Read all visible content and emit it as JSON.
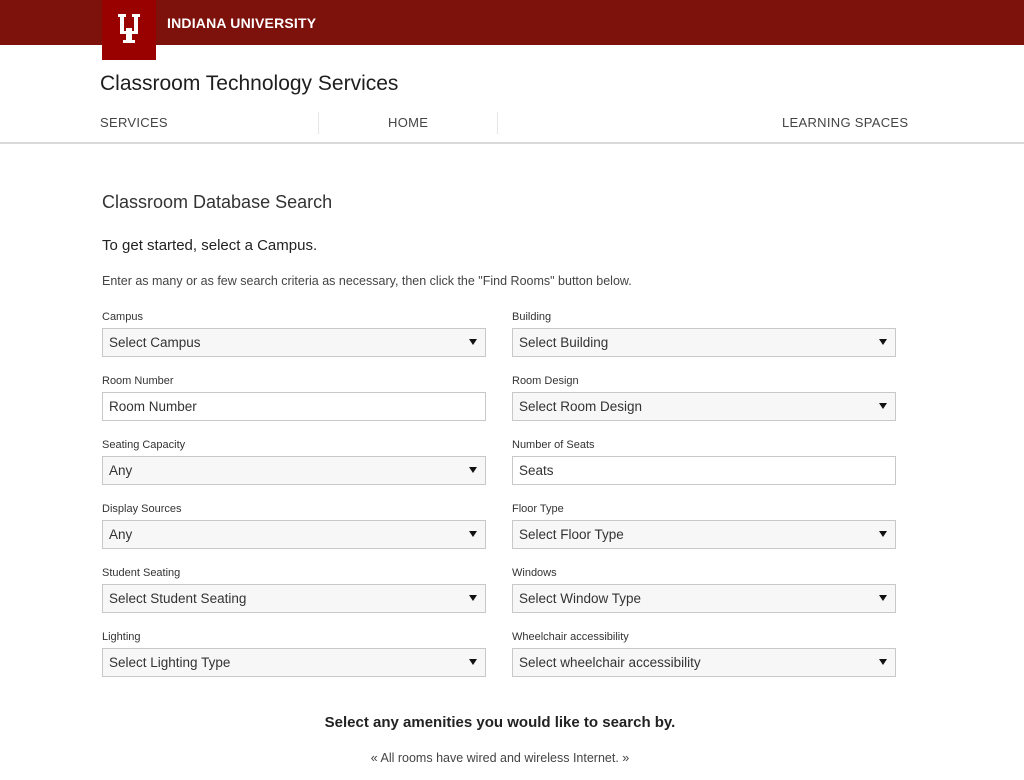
{
  "header": {
    "university": "INDIANA UNIVERSITY",
    "site_title": "Classroom Technology Services",
    "brand_color": "#7d110c",
    "logo_color": "#990000"
  },
  "nav": {
    "items": [
      {
        "label": "SERVICES"
      },
      {
        "label": "HOME"
      },
      {
        "label": "LEARNING SPACES"
      }
    ]
  },
  "main": {
    "title": "Classroom Database Search",
    "lead": "To get started, select a Campus.",
    "instructions": "Enter as many or as few search criteria as necessary, then click the \"Find Rooms\" button below.",
    "fields": {
      "campus": {
        "label": "Campus",
        "value": "Select Campus"
      },
      "building": {
        "label": "Building",
        "value": "Select Building"
      },
      "room_number": {
        "label": "Room Number",
        "placeholder": "Room Number"
      },
      "room_design": {
        "label": "Room Design",
        "value": "Select Room Design"
      },
      "seating_capacity": {
        "label": "Seating Capacity",
        "value": "Any"
      },
      "number_of_seats": {
        "label": "Number of Seats",
        "placeholder": "Seats"
      },
      "display_sources": {
        "label": "Display Sources",
        "value": "Any"
      },
      "floor_type": {
        "label": "Floor Type",
        "value": "Select Floor Type"
      },
      "student_seating": {
        "label": "Student Seating",
        "value": "Select Student Seating"
      },
      "windows": {
        "label": "Windows",
        "value": "Select Window Type"
      },
      "lighting": {
        "label": "Lighting",
        "value": "Select Lighting Type"
      },
      "wheelchair": {
        "label": "Wheelchair accessibility",
        "value": "Select wheelchair accessibility"
      }
    },
    "amenities_title": "Select any amenities you would like to search by.",
    "amenities_note": "« All rooms have wired and wireless Internet. »"
  }
}
